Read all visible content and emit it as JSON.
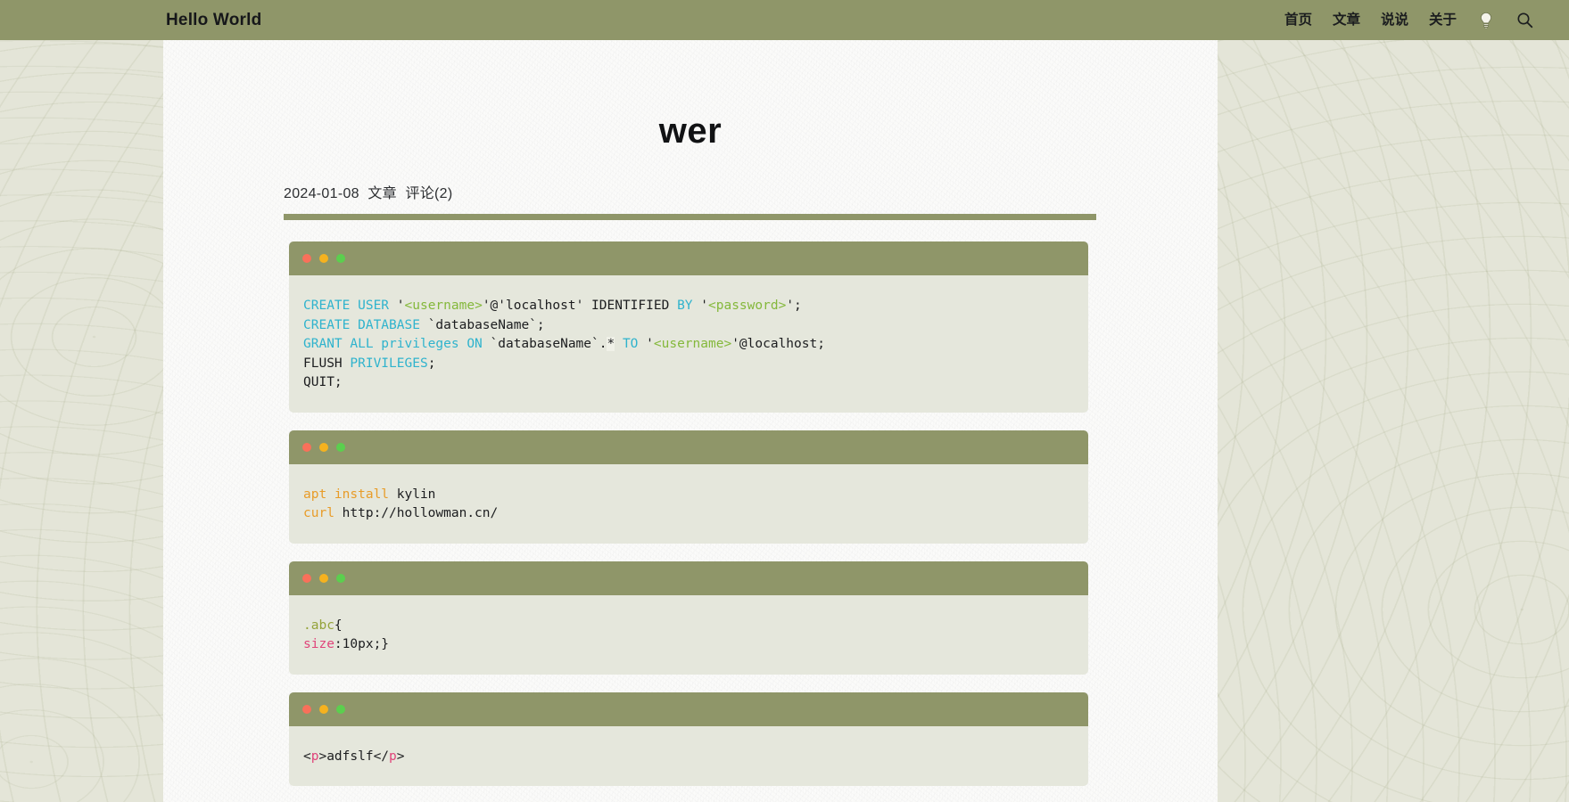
{
  "nav": {
    "brand": "Hello World",
    "links": [
      {
        "label": "首页",
        "name": "nav-home"
      },
      {
        "label": "文章",
        "name": "nav-articles"
      },
      {
        "label": "说说",
        "name": "nav-talks"
      },
      {
        "label": "关于",
        "name": "nav-about"
      }
    ],
    "icons": [
      {
        "name": "lightbulb-icon",
        "label": "lightbulb-icon"
      },
      {
        "name": "search-icon",
        "label": "search-icon"
      }
    ],
    "background_color": "#8f9669"
  },
  "post": {
    "title": "wer",
    "meta": {
      "date": "2024-01-08",
      "category": "文章",
      "comments": "评论(2)"
    },
    "rule_color": "#8f9669"
  },
  "code_blocks": [
    {
      "name": "code-block-sql",
      "language": "sql",
      "window_dots": [
        "red",
        "yellow",
        "green"
      ],
      "plain_text": "CREATE USER '<username>'@'localhost' IDENTIFIED BY '<password>';\nCREATE DATABASE `databaseName`;\nGRANT ALL privileges ON `databaseName`.* TO '<username>'@localhost;\nFLUSH PRIVILEGES;\nQUIT;",
      "lines": [
        [
          {
            "t": "CREATE USER ",
            "c": "kw"
          },
          {
            "t": "'",
            "c": "plain"
          },
          {
            "t": "<username>",
            "c": "str"
          },
          {
            "t": "'@'localhost' IDENTIFIED ",
            "c": "plain"
          },
          {
            "t": "BY ",
            "c": "kw"
          },
          {
            "t": "'",
            "c": "plain"
          },
          {
            "t": "<password>",
            "c": "str"
          },
          {
            "t": "';",
            "c": "plain"
          }
        ],
        [
          {
            "t": "CREATE DATABASE ",
            "c": "kw"
          },
          {
            "t": "`databaseName`;",
            "c": "plain"
          }
        ],
        [
          {
            "t": "GRANT ALL privileges ON ",
            "c": "kw"
          },
          {
            "t": "`databaseName`.",
            "c": "plain"
          },
          {
            "t": "*",
            "c": "star"
          },
          {
            "t": " ",
            "c": "plain"
          },
          {
            "t": "TO ",
            "c": "kw"
          },
          {
            "t": "'",
            "c": "plain"
          },
          {
            "t": "<username>",
            "c": "str"
          },
          {
            "t": "'@localhost;",
            "c": "plain"
          }
        ],
        [
          {
            "t": "FLUSH ",
            "c": "plain"
          },
          {
            "t": "PRIVILEGES",
            "c": "kw"
          },
          {
            "t": ";",
            "c": "plain"
          }
        ],
        [
          {
            "t": "QUIT;",
            "c": "plain"
          }
        ]
      ]
    },
    {
      "name": "code-block-shell",
      "language": "bash",
      "window_dots": [
        "red",
        "yellow",
        "green"
      ],
      "plain_text": "apt install kylin\ncurl http://hollowman.cn/",
      "lines": [
        [
          {
            "t": "apt install ",
            "c": "cmd"
          },
          {
            "t": "kylin",
            "c": "plain"
          }
        ],
        [
          {
            "t": "curl ",
            "c": "cmd"
          },
          {
            "t": "http://hollowman.cn/",
            "c": "plain"
          }
        ]
      ]
    },
    {
      "name": "code-block-css",
      "language": "css",
      "window_dots": [
        "red",
        "yellow",
        "green"
      ],
      "plain_text": ".abc{\nsize:10px;}",
      "lines": [
        [
          {
            "t": ".abc",
            "c": "sel"
          },
          {
            "t": "{",
            "c": "plain"
          }
        ],
        [
          {
            "t": "size",
            "c": "prop"
          },
          {
            "t": ":10px;}",
            "c": "plain"
          }
        ]
      ]
    },
    {
      "name": "code-block-html",
      "language": "html",
      "window_dots": [
        "red",
        "yellow",
        "green"
      ],
      "plain_text": "<p>adfslf</p>",
      "lines": [
        [
          {
            "t": "<",
            "c": "plain"
          },
          {
            "t": "p",
            "c": "prop"
          },
          {
            "t": ">adfslf</",
            "c": "plain"
          },
          {
            "t": "p",
            "c": "prop"
          },
          {
            "t": ">",
            "c": "plain"
          }
        ]
      ]
    }
  ],
  "colors": {
    "nav_background": "#8f9669",
    "page_background": "#e4e5d8",
    "paper_background": "#fbfbfa",
    "code_body_background": "#e5e7dc",
    "dot_red": "#f9705a",
    "dot_yellow": "#f5b21f",
    "dot_green": "#5bcf4e",
    "keyword_cyan": "#2fb3cd",
    "string_green": "#84b83b",
    "command_orange": "#e89c28",
    "css_property_pink": "#e0447a"
  }
}
